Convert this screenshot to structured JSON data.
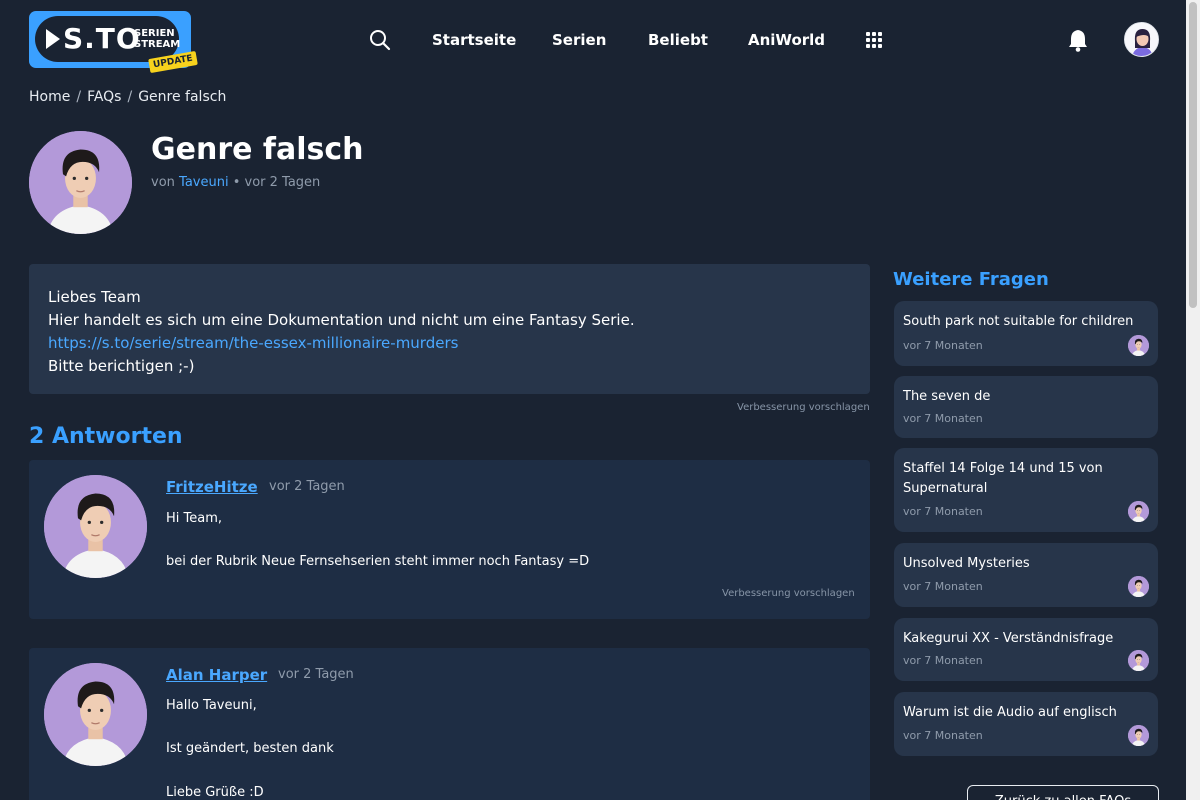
{
  "colors": {
    "background": "#1a2332",
    "card": "#27354a",
    "accent": "#3aa0ff",
    "link": "#4aa8ff",
    "badge": "#f7d21d"
  },
  "header": {
    "logo_text": "S.TO",
    "logo_sub": "SERIEN STREAM",
    "logo_badge": "UPDATE",
    "nav": [
      {
        "label": "Startseite"
      },
      {
        "label": "Serien"
      },
      {
        "label": "Beliebt"
      },
      {
        "label": "AniWorld"
      }
    ],
    "icons": {
      "search": "search-icon",
      "apps": "grid-icon",
      "notifications": "bell-icon",
      "user": "user-avatar"
    }
  },
  "breadcrumb": [
    {
      "label": "Home"
    },
    {
      "label": "FAQs"
    },
    {
      "label": "Genre falsch"
    }
  ],
  "question": {
    "title": "Genre falsch",
    "by_prefix": "von",
    "author": "Taveuni",
    "time": "• vor 2 Tagen",
    "body": [
      "Liebes Team",
      "Hier handelt es sich um eine Dokumentation und nicht um eine Fantasy Serie.",
      "https://s.to/serie/stream/the-essex-millionaire-murders",
      "Bitte berichtigen ;-)"
    ],
    "suggest": "Verbesserung vorschlagen"
  },
  "answers_title": "2 Antworten",
  "answers": [
    {
      "author": "FritzeHitze",
      "time": "vor 2 Tagen",
      "lines": [
        "Hi Team,",
        "bei der Rubrik Neue Fernsehserien steht immer noch Fantasy =D"
      ],
      "suggest": "Verbesserung vorschlagen"
    },
    {
      "author": "Alan Harper",
      "time": "vor 2 Tagen",
      "lines": [
        "Hallo Taveuni,",
        "Ist geändert, besten dank",
        "Liebe Grüße :D"
      ]
    }
  ],
  "sidebar": {
    "title": "Weitere Fragen",
    "items": [
      {
        "title": "South park not suitable for children",
        "time": "vor 7 Monaten"
      },
      {
        "title": "The seven de",
        "time": "vor 7 Monaten"
      },
      {
        "title": "Staffel 14 Folge 14 und 15 von Supernatural",
        "time": "vor 7 Monaten"
      },
      {
        "title": "Unsolved Mysteries",
        "time": "vor 7 Monaten"
      },
      {
        "title": "Kakegurui XX - Verständnisfrage",
        "time": "vor 7 Monaten"
      },
      {
        "title": "Warum ist die Audio auf englisch",
        "time": "vor 7 Monaten"
      }
    ],
    "back_button": "Zurück zu allen FAQs"
  }
}
